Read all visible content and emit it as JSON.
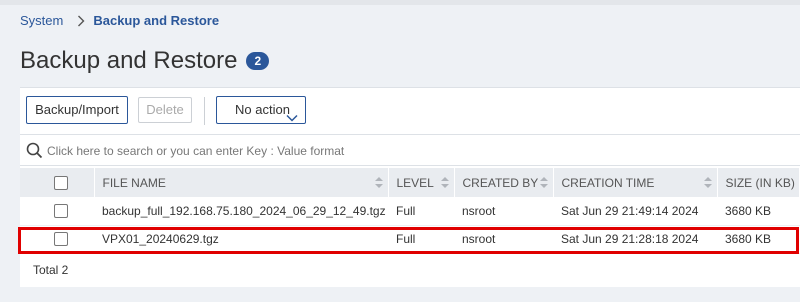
{
  "breadcrumb": {
    "root": "System",
    "current": "Backup and Restore"
  },
  "page": {
    "title": "Backup and Restore",
    "count_badge": "2"
  },
  "toolbar": {
    "backup_label": "Backup/Import",
    "delete_label": "Delete",
    "action_label": "No action"
  },
  "search": {
    "placeholder": "Click here to search or you can enter Key : Value format"
  },
  "table": {
    "columns": [
      "FILE NAME",
      "LEVEL",
      "CREATED BY",
      "CREATION TIME",
      "SIZE (IN KB)"
    ],
    "rows": [
      {
        "file_name": "backup_full_192.168.75.180_2024_06_29_12_49.tgz",
        "level": "Full",
        "created_by": "nsroot",
        "creation_time": "Sat Jun 29 21:49:14 2024",
        "size": "3680 KB"
      },
      {
        "file_name": "VPX01_20240629.tgz",
        "level": "Full",
        "created_by": "nsroot",
        "creation_time": "Sat Jun 29 21:28:18 2024",
        "size": "3680 KB"
      }
    ]
  },
  "footer": {
    "total_label": "Total 2"
  },
  "colors": {
    "accent": "#2b579a",
    "highlight": "#e00000"
  }
}
